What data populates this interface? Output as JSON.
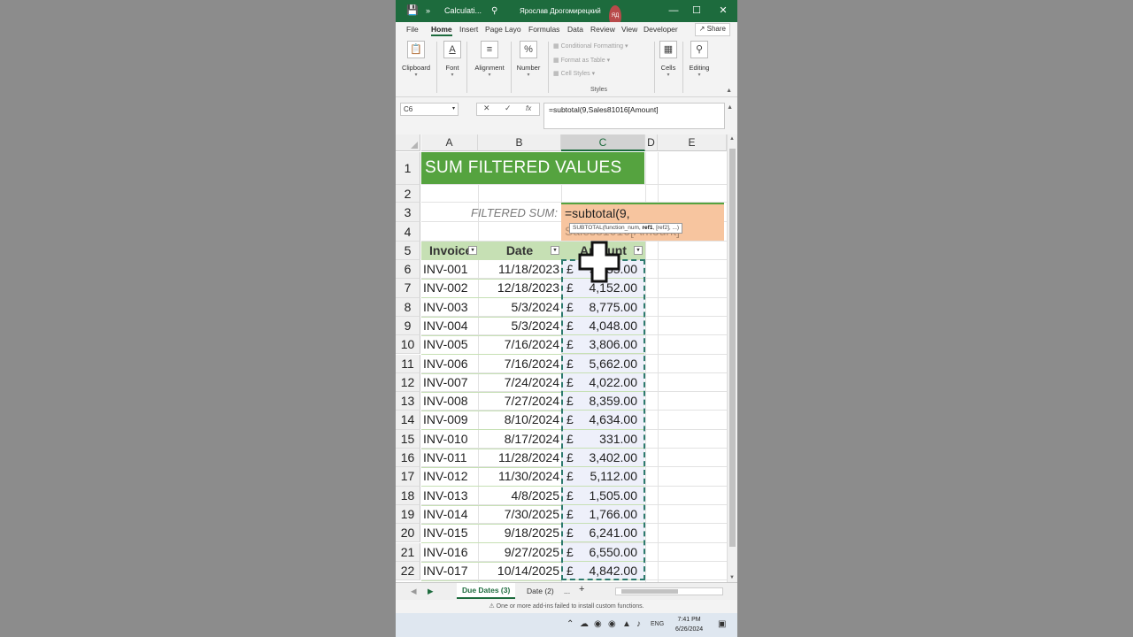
{
  "window": {
    "title": "Calculati...",
    "user": "Ярослав Дрогомирецкий",
    "user_initials": "ЯД",
    "autosave_icon": "save-icon",
    "more": "»"
  },
  "ribbon_tabs": [
    "File",
    "Home",
    "Insert",
    "Page Layo",
    "Formulas",
    "Data",
    "Review",
    "View",
    "Developer"
  ],
  "share_label": "Share",
  "ribbon": {
    "clipboard": "Clipboard",
    "font": "Font",
    "alignment": "Alignment",
    "number": "Number",
    "conditional_formatting": "Conditional Formatting",
    "format_as_table": "Format as Table",
    "cell_styles": "Cell Styles",
    "styles": "Styles",
    "cells": "Cells",
    "editing": "Editing"
  },
  "formula_bar": {
    "name_box": "C6",
    "cancel": "✕",
    "enter": "✓",
    "fx": "fx",
    "formula": "=subtotal(9,Sales81016[Amount]"
  },
  "columns": [
    "A",
    "B",
    "C",
    "D",
    "E"
  ],
  "sheet": {
    "title": "SUM FILTERED VALUES",
    "filtered_label": "FILTERED SUM:",
    "edit_line1": "=subtotal(9,",
    "edit_line2": "Sales81016[Amount]",
    "tooltip_fn": "SUBTOTAL(function_num, ",
    "tooltip_bold": "ref1",
    "tooltip_rest": ", [ref2], ...)",
    "headers": {
      "invoice": "Invoice",
      "date": "Date",
      "amount": "Amount"
    }
  },
  "rows": [
    {
      "inv": "INV-001",
      "date": "11/18/2023",
      "cur": "£",
      "amt": "9,335.00"
    },
    {
      "inv": "INV-002",
      "date": "12/18/2023",
      "cur": "£",
      "amt": "4,152.00"
    },
    {
      "inv": "INV-003",
      "date": "5/3/2024",
      "cur": "£",
      "amt": "8,775.00"
    },
    {
      "inv": "INV-004",
      "date": "5/3/2024",
      "cur": "£",
      "amt": "4,048.00"
    },
    {
      "inv": "INV-005",
      "date": "7/16/2024",
      "cur": "£",
      "amt": "3,806.00"
    },
    {
      "inv": "INV-006",
      "date": "7/16/2024",
      "cur": "£",
      "amt": "5,662.00"
    },
    {
      "inv": "INV-007",
      "date": "7/24/2024",
      "cur": "£",
      "amt": "4,022.00"
    },
    {
      "inv": "INV-008",
      "date": "7/27/2024",
      "cur": "£",
      "amt": "8,359.00"
    },
    {
      "inv": "INV-009",
      "date": "8/10/2024",
      "cur": "£",
      "amt": "4,634.00"
    },
    {
      "inv": "INV-010",
      "date": "8/17/2024",
      "cur": "£",
      "amt": "331.00"
    },
    {
      "inv": "INV-011",
      "date": "11/28/2024",
      "cur": "£",
      "amt": "3,402.00"
    },
    {
      "inv": "INV-012",
      "date": "11/30/2024",
      "cur": "£",
      "amt": "5,112.00"
    },
    {
      "inv": "INV-013",
      "date": "4/8/2025",
      "cur": "£",
      "amt": "1,505.00"
    },
    {
      "inv": "INV-014",
      "date": "7/30/2025",
      "cur": "£",
      "amt": "1,766.00"
    },
    {
      "inv": "INV-015",
      "date": "9/18/2025",
      "cur": "£",
      "amt": "6,241.00"
    },
    {
      "inv": "INV-016",
      "date": "9/27/2025",
      "cur": "£",
      "amt": "6,550.00"
    },
    {
      "inv": "INV-017",
      "date": "10/14/2025",
      "cur": "£",
      "amt": "4,842.00"
    }
  ],
  "sheet_tabs": {
    "active": "Due Dates (3)",
    "other": "Date (2)",
    "more": "...",
    "add": "+"
  },
  "status_text": "One or more add-ins failed to install custom functions.",
  "taskbar": {
    "lang": "ENG",
    "time": "7:41 PM",
    "date": "6/26/2024"
  },
  "colors": {
    "excel_green": "#1d6b3d",
    "title_fill": "#55a33f",
    "header_fill": "#c6e0b4",
    "edit_fill": "#f7c59f"
  }
}
